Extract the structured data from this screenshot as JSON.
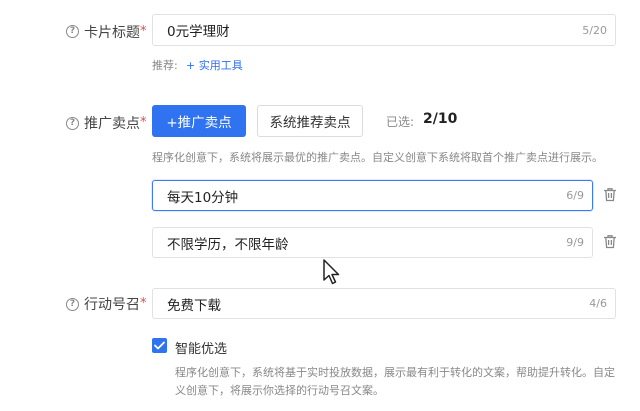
{
  "card_title": {
    "label": "卡片标题",
    "required_mark": "*",
    "value": "0元学理财",
    "counter": "5/20",
    "recommend_prefix": "推荐:",
    "recommend_link": "+ 实用工具"
  },
  "selling_points": {
    "label": "推广卖点",
    "required_mark": "*",
    "add_button": "+推广卖点",
    "system_button": "系统推荐卖点",
    "selected_prefix": "已选:",
    "selected_count": "2/10",
    "hint": "程序化创意下，系统将展示最优的推广卖点。自定义创意下系统将取首个推广卖点进行展示。",
    "items": [
      {
        "value": "每天10分钟",
        "counter": "6/9"
      },
      {
        "value": "不限学历，不限年龄",
        "counter": "9/9"
      }
    ]
  },
  "call_to_action": {
    "label": "行动号召",
    "required_mark": "*",
    "value": "免费下载",
    "counter": "4/6",
    "smart_label": "智能优选",
    "smart_checked": true,
    "hint_line1": "程序化创意下，系统将基于实时投放数据，展示最有利于转化的文案，帮助提升转化。自定",
    "hint_line2": "义创意下，将展示你选择的行动号召文案。"
  },
  "colors": {
    "primary": "#2f73f0",
    "required": "#e5484d",
    "focus_border": "#3f7bf0"
  }
}
